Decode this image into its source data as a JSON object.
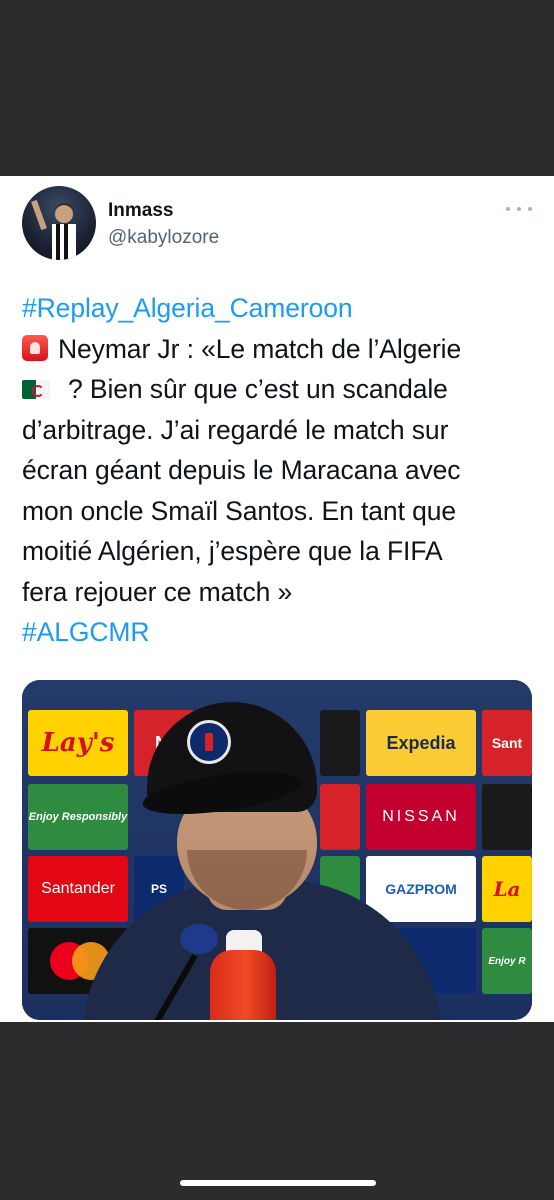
{
  "tweet": {
    "author": {
      "display_name": "Inmass",
      "handle": "@kabylozore",
      "avatar_icon": "profile-photo-icon"
    },
    "more_icon": "ellipsis-icon",
    "hashtag_top": "#Replay_Algeria_Cameroon",
    "lines": [
      "Neymar Jr : «Le match de l’Algerie",
      "? Bien sûr que c’est un scandale",
      "d’arbitrage. J’ai regardé le match sur",
      "écran géant depuis le Maracana avec",
      "mon oncle Smaïl Santos. En tant que",
      "moitié Algérien, j’espère que la FIFA",
      "fera rejouer ce match »"
    ],
    "hashtag_bottom": "#ALGCMR",
    "emoji_siren": "rotating-light-emoji",
    "emoji_flag": "flag-algeria-emoji"
  },
  "media": {
    "sponsors": {
      "lays": "Lay's",
      "expedia": "Expedia",
      "enjoy": "Enjoy Responsibly",
      "nissan": "NISSAN",
      "santander": "Santander",
      "gazprom": "GAZPROM",
      "san_short": "Sant",
      "ni_short": "NI",
      "enjoy_short": "Enjoy R",
      "lays_short": "La"
    }
  },
  "colors": {
    "hashtag": "#1d9bf0",
    "text": "#0f1419",
    "handle": "#536471",
    "frame": "#2c2c2e"
  }
}
